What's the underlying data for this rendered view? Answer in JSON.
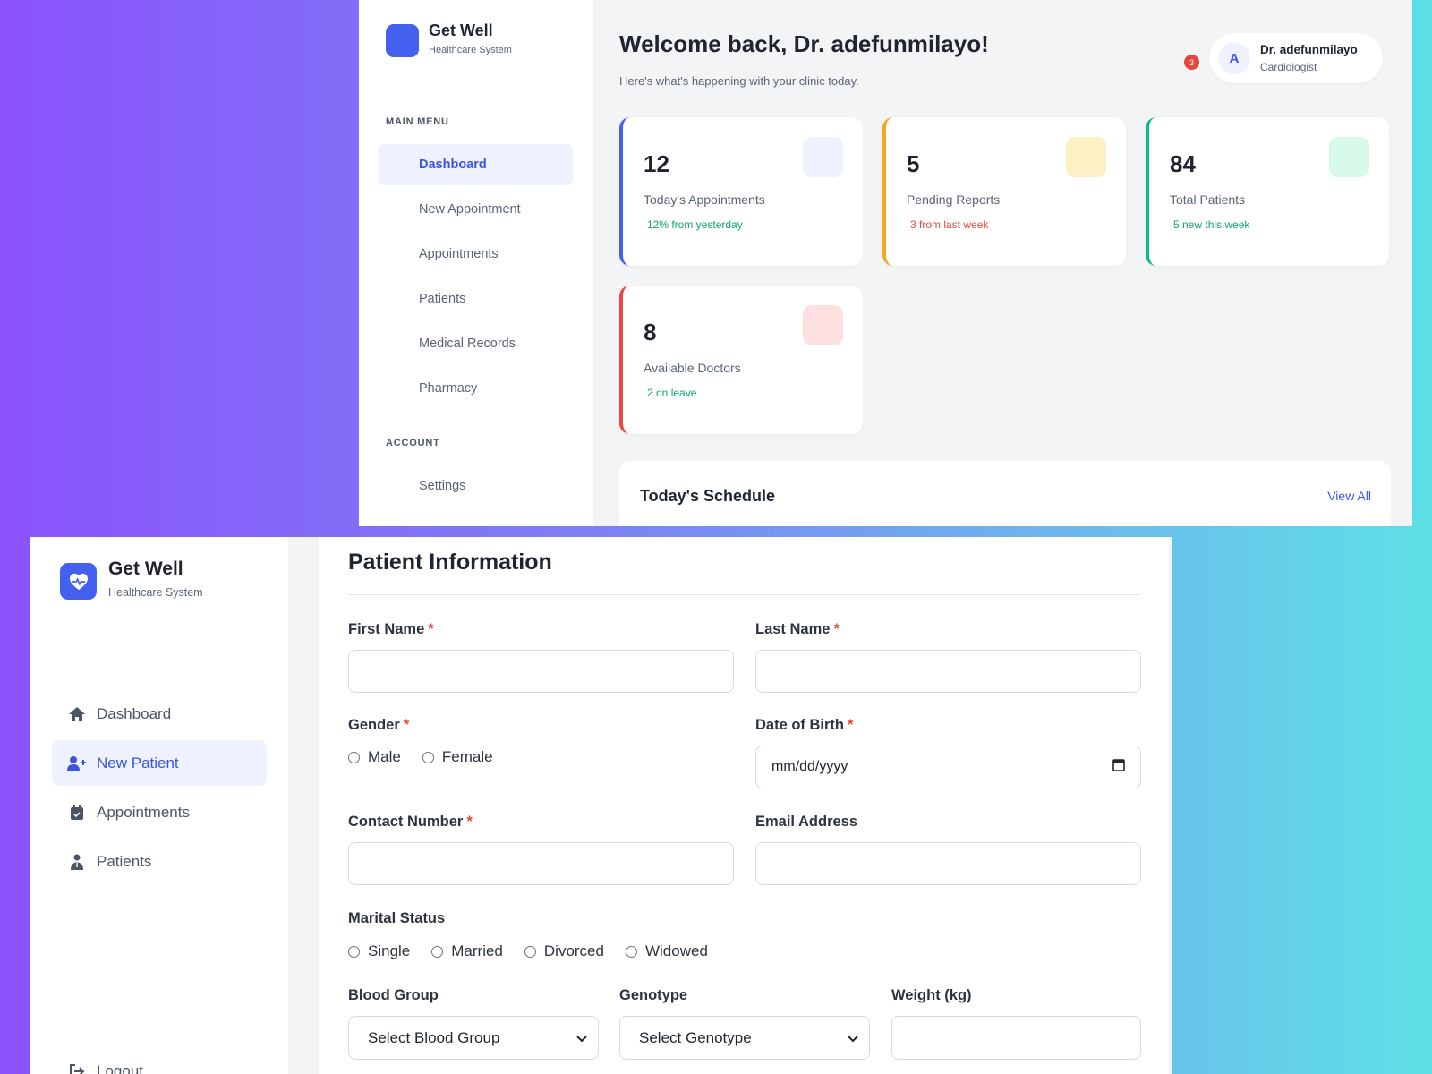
{
  "top_screen": {
    "brand": {
      "name": "Get Well",
      "subtitle": "Healthcare System"
    },
    "sections": {
      "main_menu": "MAIN MENU",
      "account": "ACCOUNT"
    },
    "main_menu": [
      {
        "label": "Dashboard",
        "active": true
      },
      {
        "label": "New Appointment",
        "active": false
      },
      {
        "label": "Appointments",
        "active": false
      },
      {
        "label": "Patients",
        "active": false
      },
      {
        "label": "Medical Records",
        "active": false
      },
      {
        "label": "Pharmacy",
        "active": false
      }
    ],
    "account_menu": [
      {
        "label": "Settings"
      }
    ],
    "header": {
      "welcome": "Welcome back, Dr. adefunmilayo!",
      "subtitle": "Here's what's happening with your clinic today.",
      "notification_count": "3",
      "user": {
        "initial": "A",
        "name": "Dr. adefunmilayo",
        "role": "Cardiologist"
      }
    },
    "stats": [
      {
        "value": "12",
        "label": "Today's Appointments",
        "note": "12% from yesterday",
        "accent": "#4460ee",
        "icon_bg": "#eef2fe",
        "note_color": "#10a36a"
      },
      {
        "value": "5",
        "label": "Pending Reports",
        "note": "3 from last week",
        "accent": "#f5a524",
        "icon_bg": "#fdf0c4",
        "note_color": "#e0493b"
      },
      {
        "value": "84",
        "label": "Total Patients",
        "note": "5 new this week",
        "accent": "#10b981",
        "icon_bg": "#d7fbe8",
        "note_color": "#10a36a"
      },
      {
        "value": "8",
        "label": "Available Doctors",
        "note": "2 on leave",
        "accent": "#ef4444",
        "icon_bg": "#fde1e1",
        "note_color": "#10a36a"
      }
    ],
    "schedule": {
      "title": "Today's Schedule",
      "link": "View All"
    }
  },
  "bottom_screen": {
    "brand": {
      "name": "Get Well",
      "subtitle": "Healthcare System",
      "icon": "heart-pulse-icon"
    },
    "nav": [
      {
        "label": "Dashboard",
        "icon": "home-icon",
        "active": false
      },
      {
        "label": "New Patient",
        "icon": "user-plus-icon",
        "active": true
      },
      {
        "label": "Appointments",
        "icon": "calendar-icon",
        "active": false
      },
      {
        "label": "Patients",
        "icon": "patient-icon",
        "active": false
      }
    ],
    "logout": "Logout",
    "form": {
      "title": "Patient Information",
      "required_mark": "*",
      "first_name": {
        "label": "First Name",
        "value": ""
      },
      "last_name": {
        "label": "Last Name",
        "value": ""
      },
      "gender": {
        "label": "Gender",
        "options": [
          "Male",
          "Female"
        ]
      },
      "dob": {
        "label": "Date of Birth",
        "placeholder": "mm/dd/yyyy"
      },
      "contact": {
        "label": "Contact Number",
        "value": ""
      },
      "email": {
        "label": "Email Address",
        "value": ""
      },
      "marital": {
        "label": "Marital Status",
        "options": [
          "Single",
          "Married",
          "Divorced",
          "Widowed"
        ]
      },
      "blood_group": {
        "label": "Blood Group",
        "selected": "Select Blood Group"
      },
      "genotype": {
        "label": "Genotype",
        "selected": "Select Genotype"
      },
      "weight": {
        "label": "Weight (kg)",
        "value": ""
      }
    }
  }
}
